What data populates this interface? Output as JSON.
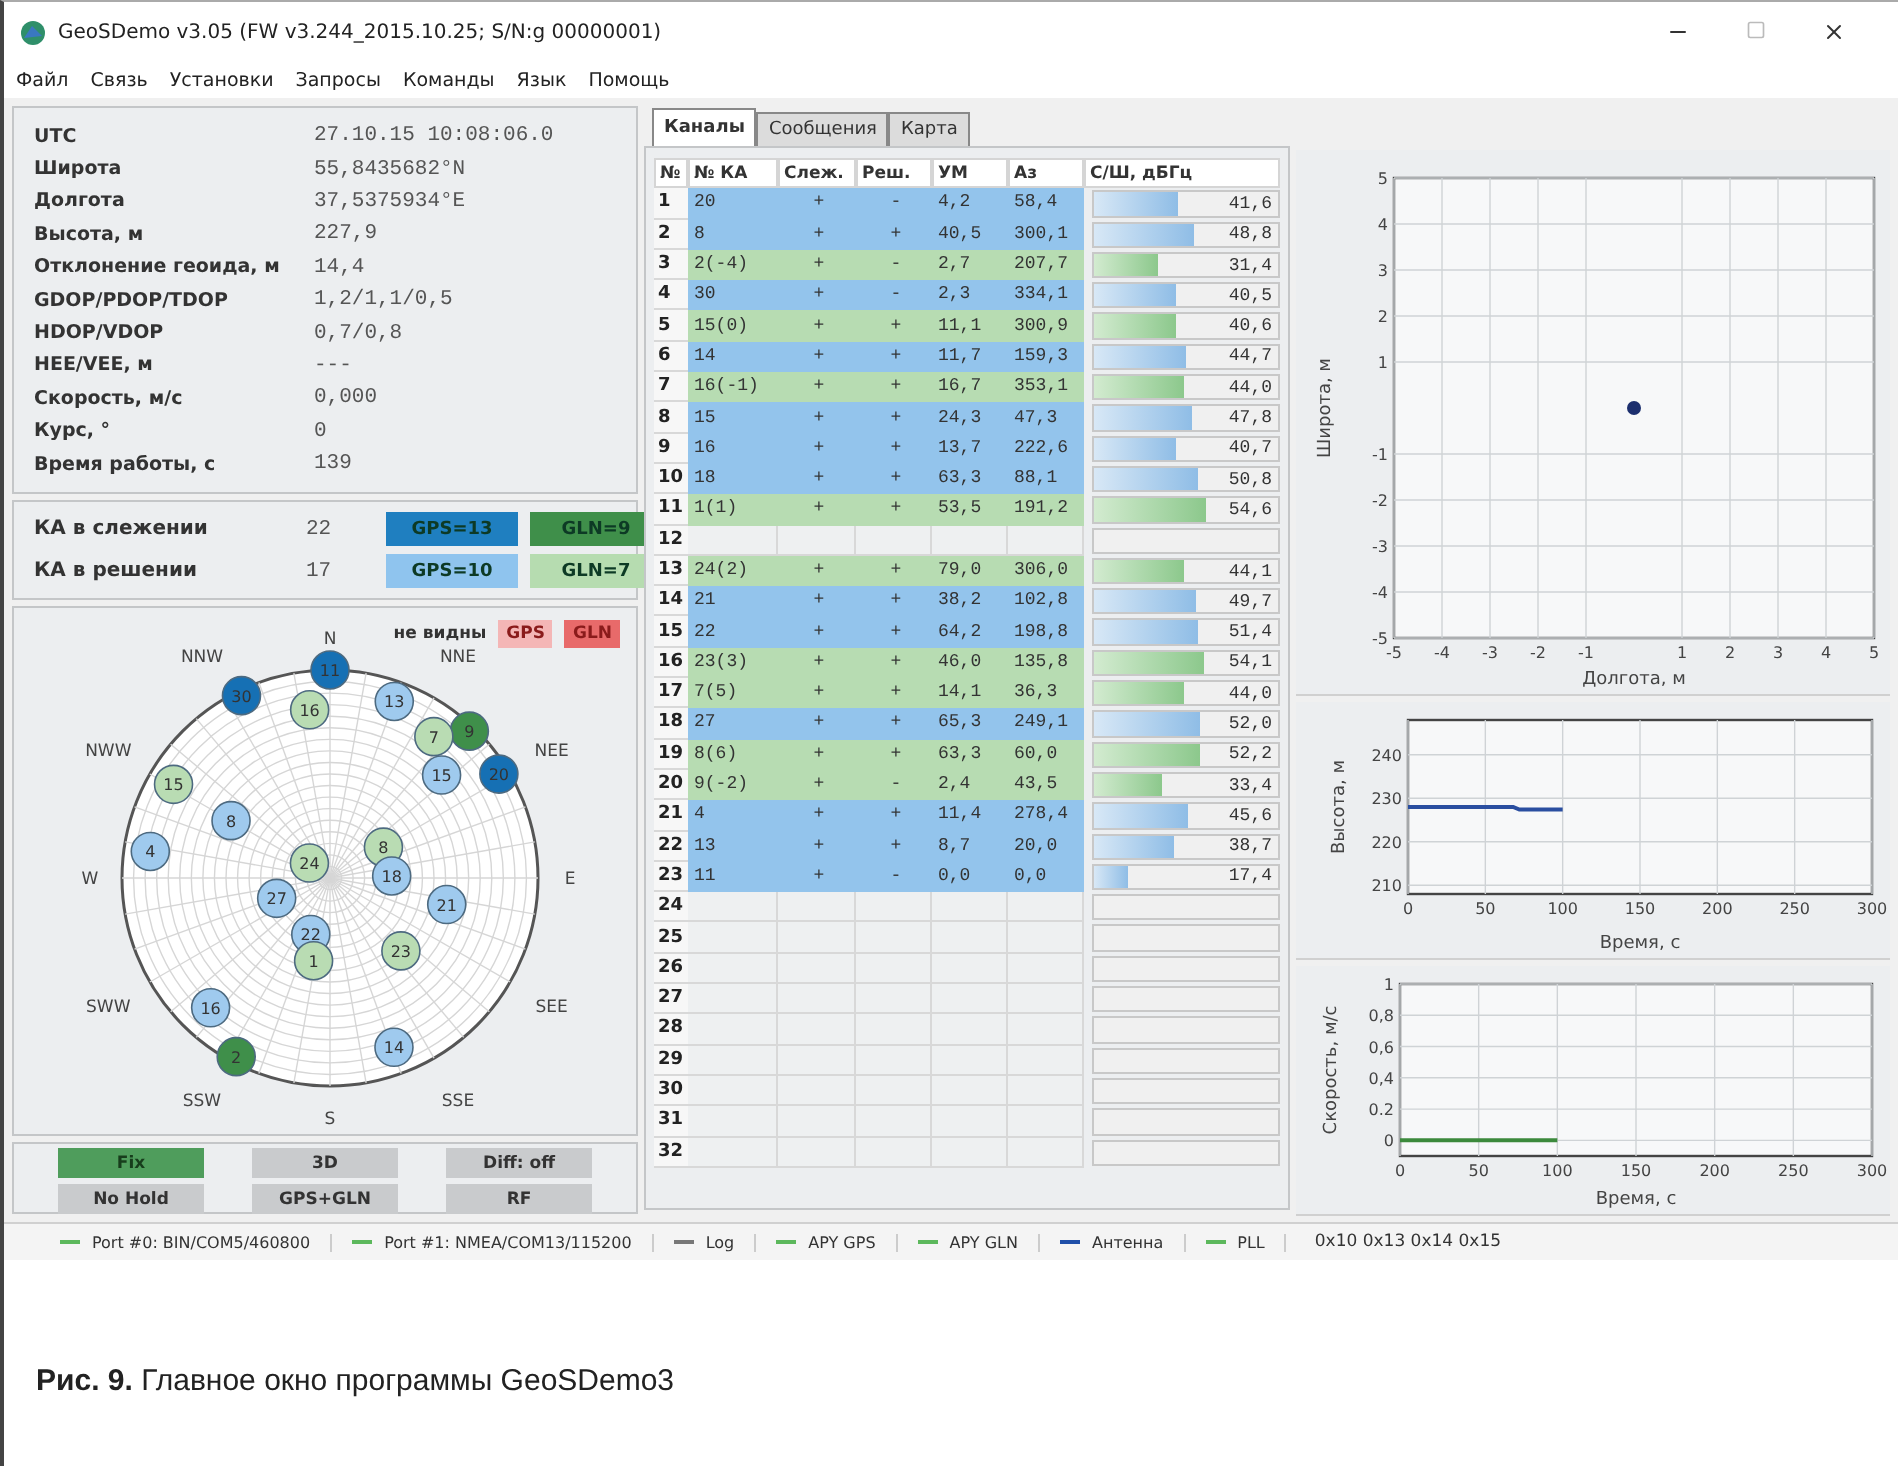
{
  "window": {
    "title": "GeoSDemo v3.05 (FW v3.244_2015.10.25; S/N:g 00000001)"
  },
  "menu": [
    "Файл",
    "Связь",
    "Установки",
    "Запросы",
    "Команды",
    "Язык",
    "Помощь"
  ],
  "info": [
    {
      "label": "UTC",
      "value": "27.10.15 10:08:06.0"
    },
    {
      "label": "Широта",
      "value": "55,8435682°N"
    },
    {
      "label": "Долгота",
      "value": "37,5375934°E"
    },
    {
      "label": "Высота, м",
      "value": "227,9"
    },
    {
      "label": "Отклонение геоида, м",
      "value": "14,4"
    },
    {
      "label": "GDOP/PDOP/TDOP",
      "value": "1,2/1,1/0,5"
    },
    {
      "label": "HDOP/VDOP",
      "value": "0,7/0,8"
    },
    {
      "label": "HEE/VEE, м",
      "value": "---"
    },
    {
      "label": "Скорость, м/с",
      "value": "0,000"
    },
    {
      "label": "Курс, °",
      "value": "0"
    },
    {
      "label": "Время работы, с",
      "value": "139"
    }
  ],
  "satellite_counts": [
    {
      "label": "КА в слежении",
      "value": "22",
      "badges": [
        {
          "text": "GPS=13",
          "color": "#1f7fc0"
        },
        {
          "text": "GLN=9",
          "color": "#3f8f4a"
        }
      ]
    },
    {
      "label": "КА в решении",
      "value": "17",
      "badges": [
        {
          "text": "GPS=10",
          "color": "#8fc4ee"
        },
        {
          "text": "GLN=7",
          "color": "#b6dcb0"
        }
      ]
    }
  ],
  "sky_plot": {
    "legend_title": "не видны",
    "legend": [
      {
        "text": "GPS",
        "color": "#f4b6b6"
      },
      {
        "text": "GLN",
        "color": "#e86a6a"
      }
    ],
    "directions": [
      "N",
      "NNW",
      "NNE",
      "NWW",
      "NEE",
      "W",
      "E",
      "SWW",
      "SEE",
      "SSW",
      "SSE",
      "S"
    ],
    "satellites": [
      {
        "label": "11",
        "color": "#1670b4"
      },
      {
        "label": "30",
        "color": "#1670b4"
      },
      {
        "label": "13",
        "color": "#9fcaee"
      },
      {
        "label": "16",
        "color": "#b9dcb3"
      },
      {
        "label": "9",
        "color": "#3f8f4a"
      },
      {
        "label": "7",
        "color": "#b9dcb3"
      },
      {
        "label": "20",
        "color": "#1670b4"
      },
      {
        "label": "15",
        "color": "#9fcaee"
      },
      {
        "label": "15",
        "color": "#b9dcb3"
      },
      {
        "label": "8",
        "color": "#9fcaee"
      },
      {
        "label": "8",
        "color": "#b9dcb3"
      },
      {
        "label": "4",
        "color": "#9fcaee"
      },
      {
        "label": "24",
        "color": "#b9dcb3"
      },
      {
        "label": "18",
        "color": "#9fcaee"
      },
      {
        "label": "27",
        "color": "#9fcaee"
      },
      {
        "label": "21",
        "color": "#9fcaee"
      },
      {
        "label": "22",
        "color": "#9fcaee"
      },
      {
        "label": "23",
        "color": "#b9dcb3"
      },
      {
        "label": "1",
        "color": "#b9dcb3"
      },
      {
        "label": "16",
        "color": "#9fcaee"
      },
      {
        "label": "14",
        "color": "#9fcaee"
      },
      {
        "label": "2",
        "color": "#3f8f4a"
      }
    ]
  },
  "status_buttons": [
    {
      "label": "Fix",
      "on": true
    },
    {
      "label": "3D",
      "on": false
    },
    {
      "label": "Diff: off",
      "on": false
    },
    {
      "label": "No Hold",
      "on": false
    },
    {
      "label": "GPS+GLN",
      "on": false
    },
    {
      "label": "RF",
      "on": false
    }
  ],
  "tabs": [
    {
      "label": "Каналы",
      "selected": true
    },
    {
      "label": "Сообщения",
      "selected": false
    },
    {
      "label": "Карта",
      "selected": false
    }
  ],
  "table": {
    "columns": [
      "№",
      "№ КА",
      "Слеж.",
      "Реш.",
      "УМ",
      "Аз",
      "С/Ш, дБГц"
    ],
    "rows": [
      {
        "number": "1",
        "kind": "gps",
        "sat": "20",
        "track": "+",
        "solve": "-",
        "el": "4,2",
        "az": "58,4",
        "snr": "41,6",
        "level": 0.46
      },
      {
        "number": "2",
        "kind": "gps",
        "sat": "8",
        "track": "+",
        "solve": "+",
        "el": "40,5",
        "az": "300,1",
        "snr": "48,8",
        "level": 0.54
      },
      {
        "number": "3",
        "kind": "gln",
        "sat": "2(-4)",
        "track": "+",
        "solve": "-",
        "el": "2,7",
        "az": "207,7",
        "snr": "31,4",
        "level": 0.35
      },
      {
        "number": "4",
        "kind": "gps",
        "sat": "30",
        "track": "+",
        "solve": "-",
        "el": "2,3",
        "az": "334,1",
        "snr": "40,5",
        "level": 0.45
      },
      {
        "number": "5",
        "kind": "gln",
        "sat": "15(0)",
        "track": "+",
        "solve": "+",
        "el": "11,1",
        "az": "300,9",
        "snr": "40,6",
        "level": 0.45
      },
      {
        "number": "6",
        "kind": "gps",
        "sat": "14",
        "track": "+",
        "solve": "+",
        "el": "11,7",
        "az": "159,3",
        "snr": "44,7",
        "level": 0.5
      },
      {
        "number": "7",
        "kind": "gln",
        "sat": "16(-1)",
        "track": "+",
        "solve": "+",
        "el": "16,7",
        "az": "353,1",
        "snr": "44,0",
        "level": 0.49
      },
      {
        "number": "8",
        "kind": "gps",
        "sat": "15",
        "track": "+",
        "solve": "+",
        "el": "24,3",
        "az": "47,3",
        "snr": "47,8",
        "level": 0.53
      },
      {
        "number": "9",
        "kind": "gps",
        "sat": "16",
        "track": "+",
        "solve": "+",
        "el": "13,7",
        "az": "222,6",
        "snr": "40,7",
        "level": 0.45
      },
      {
        "number": "10",
        "kind": "gps",
        "sat": "18",
        "track": "+",
        "solve": "+",
        "el": "63,3",
        "az": "88,1",
        "snr": "50,8",
        "level": 0.56
      },
      {
        "number": "11",
        "kind": "gln",
        "sat": "1(1)",
        "track": "+",
        "solve": "+",
        "el": "53,5",
        "az": "191,2",
        "snr": "54,6",
        "level": 0.61
      },
      {
        "number": "12",
        "kind": "empty"
      },
      {
        "number": "13",
        "kind": "gln",
        "sat": "24(2)",
        "track": "+",
        "solve": "+",
        "el": "79,0",
        "az": "306,0",
        "snr": "44,1",
        "level": 0.49
      },
      {
        "number": "14",
        "kind": "gps",
        "sat": "21",
        "track": "+",
        "solve": "+",
        "el": "38,2",
        "az": "102,8",
        "snr": "49,7",
        "level": 0.55
      },
      {
        "number": "15",
        "kind": "gps",
        "sat": "22",
        "track": "+",
        "solve": "+",
        "el": "64,2",
        "az": "198,8",
        "snr": "51,4",
        "level": 0.57
      },
      {
        "number": "16",
        "kind": "gln",
        "sat": "23(3)",
        "track": "+",
        "solve": "+",
        "el": "46,0",
        "az": "135,8",
        "snr": "54,1",
        "level": 0.6
      },
      {
        "number": "17",
        "kind": "gln",
        "sat": "7(5)",
        "track": "+",
        "solve": "+",
        "el": "14,1",
        "az": "36,3",
        "snr": "44,0",
        "level": 0.49
      },
      {
        "number": "18",
        "kind": "gps",
        "sat": "27",
        "track": "+",
        "solve": "+",
        "el": "65,3",
        "az": "249,1",
        "snr": "52,0",
        "level": 0.58
      },
      {
        "number": "19",
        "kind": "gln",
        "sat": "8(6)",
        "track": "+",
        "solve": "+",
        "el": "63,3",
        "az": "60,0",
        "snr": "52,2",
        "level": 0.58
      },
      {
        "number": "20",
        "kind": "gln",
        "sat": "9(-2)",
        "track": "+",
        "solve": "-",
        "el": "2,4",
        "az": "43,5",
        "snr": "33,4",
        "level": 0.37
      },
      {
        "number": "21",
        "kind": "gps",
        "sat": "4",
        "track": "+",
        "solve": "+",
        "el": "11,4",
        "az": "278,4",
        "snr": "45,6",
        "level": 0.51
      },
      {
        "number": "22",
        "kind": "gps",
        "sat": "13",
        "track": "+",
        "solve": "+",
        "el": "8,7",
        "az": "20,0",
        "snr": "38,7",
        "level": 0.43
      },
      {
        "number": "23",
        "kind": "gps",
        "sat": "11",
        "track": "+",
        "solve": "-",
        "el": "0,0",
        "az": "0,0",
        "snr": "17,4",
        "level": 0.19
      },
      {
        "number": "24",
        "kind": "empty"
      },
      {
        "number": "25",
        "kind": "empty"
      },
      {
        "number": "26",
        "kind": "empty"
      },
      {
        "number": "27",
        "kind": "empty"
      },
      {
        "number": "28",
        "kind": "empty"
      },
      {
        "number": "29",
        "kind": "empty"
      },
      {
        "number": "30",
        "kind": "empty"
      },
      {
        "number": "31",
        "kind": "empty"
      },
      {
        "number": "32",
        "kind": "empty"
      }
    ]
  },
  "charts": [
    {
      "chart_data": {
        "type": "scatter",
        "grid": true,
        "xlabel": "Долгота, м",
        "ylabel": "Широта, м",
        "x": [
          0
        ],
        "series": [
          {
            "color": "#1c2f6e",
            "values": [
              0
            ]
          }
        ],
        "xlim": [
          -5,
          5
        ],
        "ylim": [
          -5,
          5
        ],
        "xticks": [
          -5,
          -4,
          -3,
          -2,
          -1,
          1,
          2,
          3,
          4,
          5
        ],
        "yticks": [
          -5,
          -4,
          -3,
          -2,
          -1,
          1,
          2,
          3,
          4,
          5
        ]
      }
    },
    {
      "chart_data": {
        "type": "line",
        "grid": true,
        "xlabel": "Время, с",
        "ylabel": "Высота, м",
        "x": [
          0,
          68,
          72,
          100
        ],
        "series": [
          {
            "color": "#2a4ea0",
            "values": [
              228,
              228,
              227.4,
              227.4
            ]
          }
        ],
        "xlim": [
          0,
          300
        ],
        "ylim": [
          208,
          248
        ],
        "xticks": [
          0,
          50,
          100,
          150,
          200,
          250,
          300
        ],
        "yticks": [
          210,
          220,
          230,
          240
        ]
      }
    },
    {
      "chart_data": {
        "type": "line",
        "grid": true,
        "xlabel": "Время, с",
        "ylabel": "Скорость, м/с",
        "x": [
          0,
          100
        ],
        "series": [
          {
            "color": "#3c8a3c",
            "values": [
              0,
              0
            ]
          }
        ],
        "xlim": [
          0,
          300
        ],
        "ylim": [
          -0.1,
          1
        ],
        "xticks": [
          0,
          50,
          100,
          150,
          200,
          250,
          300
        ],
        "yticks": [
          0,
          {
            "value": 0.2,
            "label": "0.2"
          },
          {
            "value": 0.4,
            "label": "0,4"
          },
          {
            "value": 0.6,
            "label": "0,6"
          },
          {
            "value": 0.8,
            "label": "0,8"
          },
          1
        ]
      }
    }
  ],
  "status_bar": {
    "items": [
      {
        "label": "Port #0: BIN/COM5/460800",
        "color": "#5cb85c"
      },
      {
        "label": "Port #1: NMEA/COM13/115200",
        "color": "#5cb85c"
      },
      {
        "label": "Log",
        "color": "#777777"
      },
      {
        "label": "APY GPS",
        "color": "#5cb85c"
      },
      {
        "label": "APY GLN",
        "color": "#5cb85c"
      },
      {
        "label": "Антенна",
        "color": "#1f4fa8"
      },
      {
        "label": "PLL",
        "color": "#5cb85c"
      }
    ],
    "codes": "0x10 0x13 0x14 0x15"
  },
  "caption": "**Рис. 9.** Главное окно программы GeoSDemo3"
}
